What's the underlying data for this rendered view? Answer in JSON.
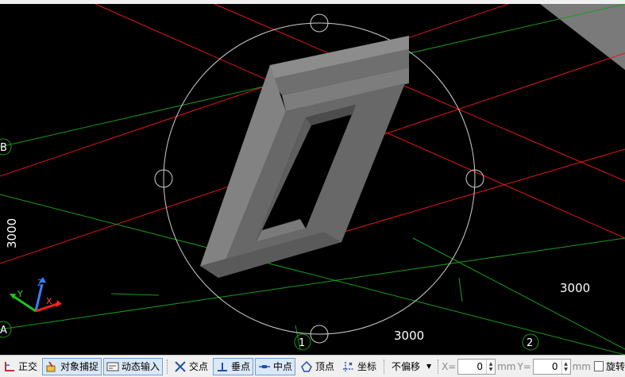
{
  "viewport": {
    "grid_labels": {
      "row_b": "B",
      "row_a": "A",
      "col_1": "1",
      "col_2": "2"
    },
    "dimensions": {
      "vertical": "3000",
      "bottom": "3000",
      "right": "3000"
    },
    "axes": {
      "x": "X",
      "y": "Y",
      "z": "Z"
    },
    "colors": {
      "background": "#000000",
      "red_axis": "#ff2020",
      "green_axis": "#1aa01a",
      "solid": "#6e6e6e",
      "orbit": "#d0d0d0"
    }
  },
  "statusbar": {
    "ortho": "正交",
    "object_snap": "对象捕捉",
    "dynamic_input": "动态输入",
    "intersection": "交点",
    "perpendicular": "垂点",
    "midpoint": "中点",
    "vertex": "顶点",
    "coordinate": "坐标",
    "offset_mode": "不偏移",
    "x_label": "X=",
    "x_value": "0",
    "x_unit": "mm",
    "y_label": "Y=",
    "y_value": "0",
    "y_unit": "mm",
    "rotate": "旋转"
  }
}
